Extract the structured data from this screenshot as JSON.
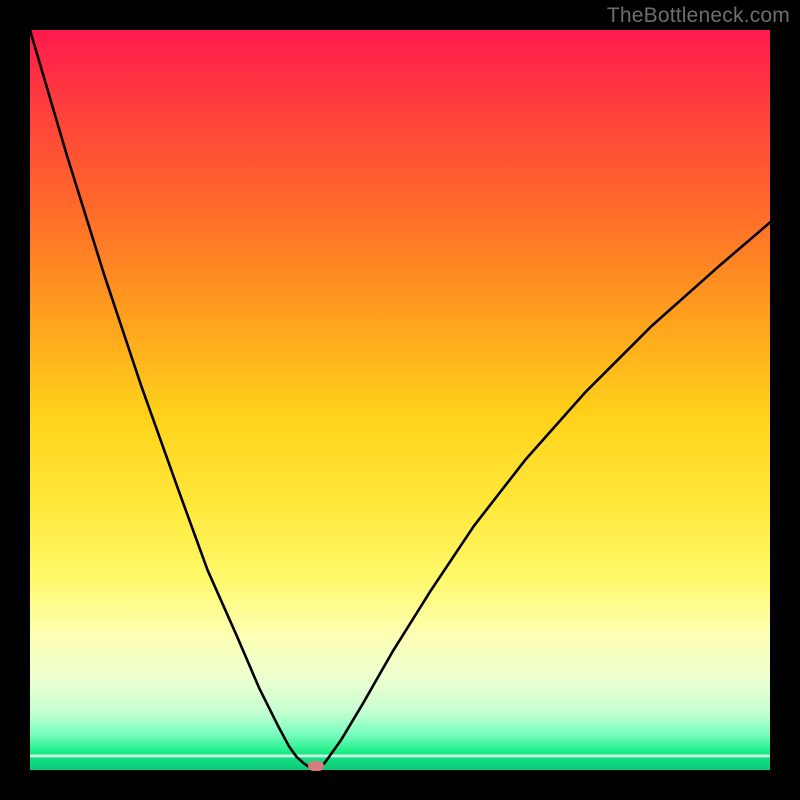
{
  "watermark": "TheBottleneck.com",
  "colors": {
    "frame": "#000000",
    "curve": "#000000",
    "marker": "#d47d7d",
    "gradient_top": "#ff1a4d",
    "gradient_bottom": "#0fc878"
  },
  "chart_data": {
    "type": "line",
    "title": "",
    "xlabel": "",
    "ylabel": "",
    "xlim": [
      0,
      100
    ],
    "ylim": [
      0,
      100
    ],
    "grid": false,
    "series": [
      {
        "name": "bottleneck-curve",
        "x": [
          0,
          5,
          10,
          15,
          20,
          24,
          28,
          31,
          33.5,
          35,
          36,
          37,
          37.8,
          38.6,
          39.3,
          40,
          42,
          45,
          49,
          54,
          60,
          67,
          75,
          84,
          93,
          100
        ],
        "y": [
          100,
          83,
          67,
          52,
          38,
          27,
          18,
          11,
          6,
          3.2,
          1.8,
          0.9,
          0.35,
          0.1,
          0.35,
          1.2,
          4,
          9,
          16,
          24,
          33,
          42,
          51,
          60,
          68,
          74
        ]
      }
    ],
    "annotations": [
      {
        "name": "optimal-marker",
        "x": 38.6,
        "y": 0.5
      }
    ]
  }
}
